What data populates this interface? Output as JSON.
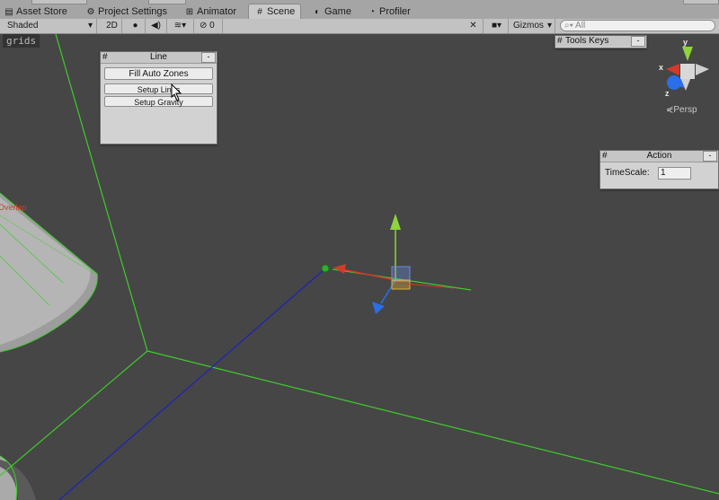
{
  "tabs": [
    {
      "label": "Asset Store",
      "icon": "cart-icon"
    },
    {
      "label": "Project Settings",
      "icon": "gear-icon"
    },
    {
      "label": "Animator",
      "icon": "animator-icon"
    },
    {
      "label": "Scene",
      "icon": "grid-icon",
      "active": true
    },
    {
      "label": "Game",
      "icon": "game-icon"
    },
    {
      "label": "Profiler",
      "icon": "profiler-icon"
    }
  ],
  "toolbar": {
    "shading_mode": "Shaded",
    "mode_2d": "2D",
    "hidden_count": "0",
    "gizmos": "Gizmos",
    "search_placeholder": "All"
  },
  "overlay_label": "grids",
  "line_window": {
    "title": "Line",
    "minimize": "-",
    "hash": "#",
    "buttons": [
      "Fill Auto Zones",
      "Setup Lines",
      "Setup Gravity"
    ]
  },
  "tools_keys_window": {
    "title": "Tools Keys",
    "minimize": "-",
    "hash": "#"
  },
  "action_window": {
    "title": "Action",
    "minimize": "-",
    "hash": "#",
    "timescale_label": "TimeScale:",
    "timescale_value": "1"
  },
  "gizmo": {
    "x": "x",
    "y": "y",
    "z": "z",
    "view": "Persp"
  },
  "scene_label": "Overlap",
  "colors": {
    "scene_bg": "#464646",
    "grid_line": "#3dcc2a",
    "axis_blue": "#1c22b8",
    "x_axis": "#d23a2a",
    "y_axis": "#8ed43a",
    "z_axis": "#2a6ee8"
  }
}
